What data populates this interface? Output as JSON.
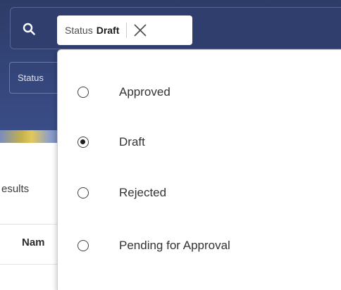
{
  "search": {
    "icon": "search-icon",
    "chip": {
      "label": "Status",
      "value": "Draft",
      "close_icon": "close-icon"
    }
  },
  "filters": {
    "status_chip_label": "Status"
  },
  "results": {
    "label": "esults",
    "column_name_header": "Nam"
  },
  "dropdown": {
    "options": [
      {
        "label": "Approved",
        "selected": false
      },
      {
        "label": "Draft",
        "selected": true
      },
      {
        "label": "Rejected",
        "selected": false
      },
      {
        "label": "Pending for Approval",
        "selected": false
      }
    ]
  },
  "colors": {
    "header_bg": "#34457a",
    "accent": "#1d1d1d"
  }
}
